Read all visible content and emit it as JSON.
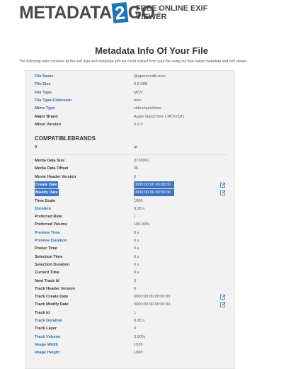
{
  "header": {
    "logo_left": "METADATA",
    "logo_num": "2",
    "logo_right": "GO",
    "logo_com": ".com",
    "tagline": "FREE ONLINE EXIF VIEWER"
  },
  "page": {
    "title": "Metadata Info Of Your File",
    "intro": "The following table contains all the exif data and metadata info we could extract from your file using our free online metadata and exif viewer."
  },
  "section_compat": "COMPATIBLEBRANDS",
  "rows_a": [
    {
      "key": "File Name",
      "value": "@opersvodki.mov",
      "blue": true
    },
    {
      "key": "File Size",
      "value": "3.6 MiB",
      "blue": true
    },
    {
      "key": "File Type",
      "value": "MOV",
      "blue": true
    },
    {
      "key": "File Type Extension",
      "value": "mov",
      "blue": true
    },
    {
      "key": "Mime Type",
      "value": "video/quicktime",
      "blue": true
    },
    {
      "key": "Major Brand",
      "value": "Apple QuickTime (.MOV/QT)",
      "blue": false
    },
    {
      "key": "Minor Version",
      "value": "0.2.0",
      "blue": false
    }
  ],
  "compat_row": {
    "key": "0",
    "value": "qt"
  },
  "rows_b": [
    {
      "key": "Media Data Size",
      "value": "3716961",
      "blue": false,
      "selected": false,
      "editable": false
    },
    {
      "key": "Media Data Offset",
      "value": "36",
      "blue": false,
      "selected": false,
      "editable": false
    },
    {
      "key": "Movie Header Version",
      "value": "0",
      "blue": false,
      "selected": false,
      "editable": false
    },
    {
      "key": "Create Date",
      "value": "0000:00:00 00:00:00",
      "blue": true,
      "selected": true,
      "editable": true
    },
    {
      "key": "Modify Date",
      "value": "0000:00:00 00:00:00",
      "blue": true,
      "selected": true,
      "editable": true
    },
    {
      "key": "Time Scale",
      "value": "1000",
      "blue": false,
      "selected": false,
      "editable": false
    },
    {
      "key": "Duration",
      "value": "8.28 s",
      "blue": true,
      "selected": false,
      "editable": false
    },
    {
      "key": "Preferred Rate",
      "value": "1",
      "blue": false,
      "selected": false,
      "editable": false
    },
    {
      "key": "Preferred Volume",
      "value": "100.00%",
      "blue": false,
      "selected": false,
      "editable": false
    },
    {
      "key": "Preview Time",
      "value": "0 s",
      "blue": true,
      "selected": false,
      "editable": false
    },
    {
      "key": "Preview Duration",
      "value": "0 s",
      "blue": true,
      "selected": false,
      "editable": false
    },
    {
      "key": "Poster Time",
      "value": "0 s",
      "blue": false,
      "selected": false,
      "editable": false
    },
    {
      "key": "Selection Time",
      "value": "0 s",
      "blue": false,
      "selected": false,
      "editable": false
    },
    {
      "key": "Selection Duration",
      "value": "0 s",
      "blue": false,
      "selected": false,
      "editable": false
    },
    {
      "key": "Current Time",
      "value": "0 s",
      "blue": false,
      "selected": false,
      "editable": false
    },
    {
      "key": "Next Track Id",
      "value": "3",
      "blue": false,
      "selected": false,
      "editable": false
    },
    {
      "key": "Track Header Version",
      "value": "0",
      "blue": false,
      "selected": false,
      "editable": false
    },
    {
      "key": "Track Create Date",
      "value": "0000:00:00 00:00:00",
      "blue": false,
      "selected": false,
      "editable": true
    },
    {
      "key": "Track Modify Date",
      "value": "0000:00:00 00:00:00",
      "blue": false,
      "selected": false,
      "editable": true
    },
    {
      "key": "Track Id",
      "value": "1",
      "blue": false,
      "selected": false,
      "editable": false
    },
    {
      "key": "Track Duration",
      "value": "8.28 s",
      "blue": true,
      "selected": false,
      "editable": false
    },
    {
      "key": "Track Layer",
      "value": "0",
      "blue": false,
      "selected": false,
      "editable": false
    },
    {
      "key": "Track Volume",
      "value": "0.00%",
      "blue": true,
      "selected": false,
      "editable": false
    },
    {
      "key": "Image Width",
      "value": "1920",
      "blue": true,
      "selected": false,
      "editable": false
    },
    {
      "key": "Image Height",
      "value": "1080",
      "blue": true,
      "selected": false,
      "editable": false
    }
  ],
  "icons": {
    "edit": "edit-icon"
  },
  "colors": {
    "link_blue": "#2e6aa6",
    "selection": "#3a72c6",
    "logo_blue": "#1a75bb"
  }
}
